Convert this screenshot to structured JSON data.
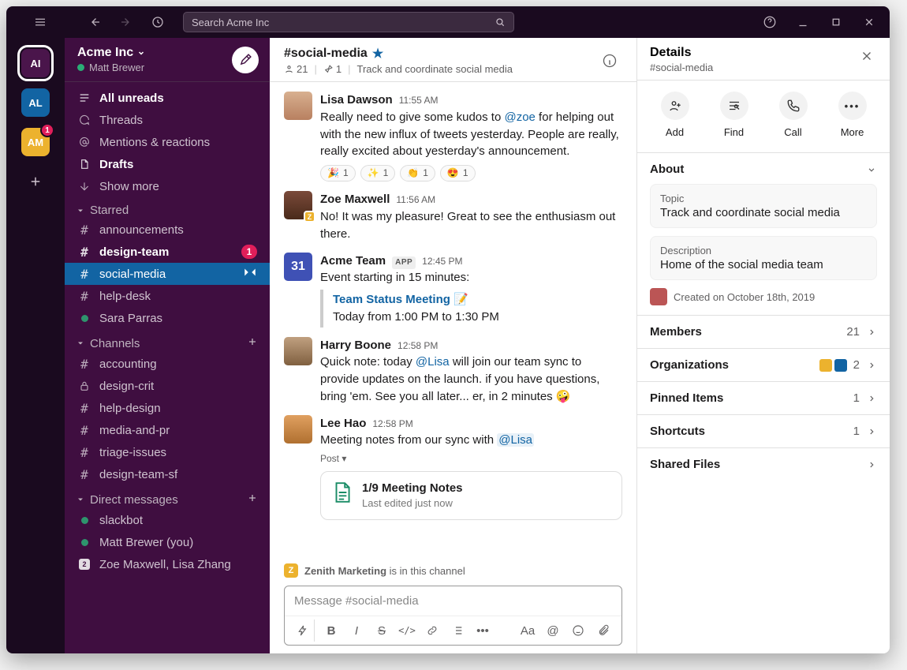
{
  "search_placeholder": "Search Acme Inc",
  "workspaces": [
    {
      "initials": "AI",
      "color": "#4a154b",
      "selected": true
    },
    {
      "initials": "AL",
      "color": "#1264a3",
      "badge": ""
    },
    {
      "initials": "AM",
      "color": "#ecb22e",
      "badge": "1"
    }
  ],
  "workspace": {
    "name": "Acme Inc",
    "user": "Matt Brewer"
  },
  "nav": {
    "all_unreads": "All unreads",
    "threads": "Threads",
    "mentions": "Mentions & reactions",
    "drafts": "Drafts",
    "show_more": "Show more"
  },
  "sections": {
    "starred": {
      "label": "Starred",
      "items": [
        {
          "icon": "hash",
          "label": "announcements"
        },
        {
          "icon": "hash",
          "label": "design-team",
          "bold": true,
          "badge": "1"
        },
        {
          "icon": "hash",
          "label": "social-media",
          "active": true,
          "rightIcon": "stack"
        },
        {
          "icon": "hash",
          "label": "help-desk"
        },
        {
          "icon": "presence",
          "label": "Sara Parras"
        }
      ]
    },
    "channels": {
      "label": "Channels",
      "items": [
        {
          "icon": "hash",
          "label": "accounting"
        },
        {
          "icon": "lock",
          "label": "design-crit"
        },
        {
          "icon": "hash",
          "label": "help-design"
        },
        {
          "icon": "hash",
          "label": "media-and-pr"
        },
        {
          "icon": "hash",
          "label": "triage-issues"
        },
        {
          "icon": "hash",
          "label": "design-team-sf"
        }
      ]
    },
    "dms": {
      "label": "Direct messages",
      "items": [
        {
          "icon": "presence",
          "label": "slackbot"
        },
        {
          "icon": "presence",
          "label": "Matt Brewer (you)"
        },
        {
          "icon": "count2",
          "label": "Zoe Maxwell, Lisa Zhang"
        }
      ]
    }
  },
  "channel": {
    "name": "#social-media",
    "members": "21",
    "pins": "1",
    "topic": "Track and coordinate social media"
  },
  "messages": {
    "m0": {
      "name": "Lisa Dawson",
      "time": "11:55 AM",
      "paragraph_pre": "Really need to give some kudos to ",
      "mention": "@zoe",
      "paragraph_post": " for helping out with the new influx of tweets yesterday. People are really, really excited about yesterday's announcement.",
      "reacts": [
        [
          "🎉",
          "1"
        ],
        [
          "✨",
          "1"
        ],
        [
          "👏",
          "1"
        ],
        [
          "😍",
          "1"
        ]
      ]
    },
    "m1": {
      "name": "Zoe Maxwell",
      "time": "11:56 AM",
      "text": "No! It was my pleasure! Great to see the enthusiasm out there."
    },
    "m2": {
      "name": "Acme Team",
      "tag": "APP",
      "time": "12:45 PM",
      "lead": "Event starting in 15 minutes:",
      "ev_title": "Team Status Meeting 📝",
      "ev_time": "Today from 1:00 PM to 1:30 PM"
    },
    "m3": {
      "name": "Harry Boone",
      "time": "12:58 PM",
      "pre": "Quick note: today ",
      "mention": "@Lisa",
      "post": " will join our team sync to provide updates on the launch. if you have questions, bring 'em. See you all later... er, in 2 minutes 🤪"
    },
    "m4": {
      "name": "Lee Hao",
      "time": "12:58 PM",
      "pre": "Meeting notes from our sync with ",
      "mention": "@Lisa",
      "post_label": "Post ▾",
      "doc_title": "1/9 Meeting Notes",
      "doc_sub": "Last edited just now"
    }
  },
  "banner": {
    "org": "Zenith Marketing",
    "tail": " is in this channel"
  },
  "composer": {
    "placeholder": "Message #social-media"
  },
  "details": {
    "title": "Details",
    "subtitle": "#social-media",
    "actions": {
      "add": "Add",
      "find": "Find",
      "call": "Call",
      "more": "More"
    },
    "about": {
      "label": "About",
      "topic_label": "Topic",
      "topic": "Track and coordinate social media",
      "desc_label": "Description",
      "desc": "Home of the social media team",
      "created": "Created on October 18th, 2019"
    },
    "rows": {
      "members": {
        "label": "Members",
        "count": "21"
      },
      "orgs": {
        "label": "Organizations",
        "count": "2"
      },
      "pinned": {
        "label": "Pinned Items",
        "count": "1"
      },
      "shortcuts": {
        "label": "Shortcuts",
        "count": "1"
      },
      "shared": {
        "label": "Shared Files"
      }
    }
  }
}
